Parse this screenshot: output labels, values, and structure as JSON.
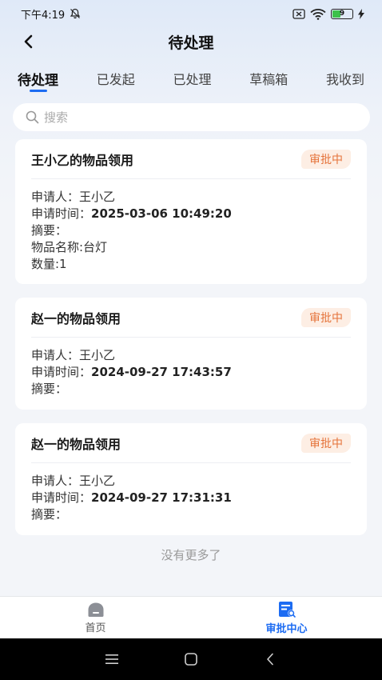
{
  "status_bar": {
    "time": "下午4:19",
    "battery": "9"
  },
  "header": {
    "title": "待处理"
  },
  "tabs": [
    {
      "label": "待处理",
      "active": true
    },
    {
      "label": "已发起",
      "active": false
    },
    {
      "label": "已处理",
      "active": false
    },
    {
      "label": "草稿箱",
      "active": false
    },
    {
      "label": "我收到",
      "active": false
    }
  ],
  "search": {
    "placeholder": "搜索",
    "value": ""
  },
  "cards": [
    {
      "title": "王小乙的物品领用",
      "status": "审批中",
      "applicant_label": "申请人：",
      "applicant": "王小乙",
      "time_label": "申请时间：",
      "time": "2025-03-06 10:49:20",
      "summary_label": "摘要：",
      "extra": [
        "物品名称:台灯",
        "数量:1"
      ]
    },
    {
      "title": "赵一的物品领用",
      "status": "审批中",
      "applicant_label": "申请人：",
      "applicant": "王小乙",
      "time_label": "申请时间：",
      "time": "2024-09-27 17:43:57",
      "summary_label": "摘要："
    },
    {
      "title": "赵一的物品领用",
      "status": "审批中",
      "applicant_label": "申请人：",
      "applicant": "王小乙",
      "time_label": "申请时间：",
      "time": "2024-09-27 17:31:31",
      "summary_label": "摘要："
    }
  ],
  "footer_text": "没有更多了",
  "bottom_nav": [
    {
      "label": "首页",
      "icon": "home-icon",
      "active": false
    },
    {
      "label": "审批中心",
      "icon": "approval-center-icon",
      "active": true
    }
  ],
  "colors": {
    "accent": "#1d6cf2",
    "badge_bg": "#fdeee4",
    "badge_text": "#e5733a",
    "battery_green": "#3cc14a"
  }
}
